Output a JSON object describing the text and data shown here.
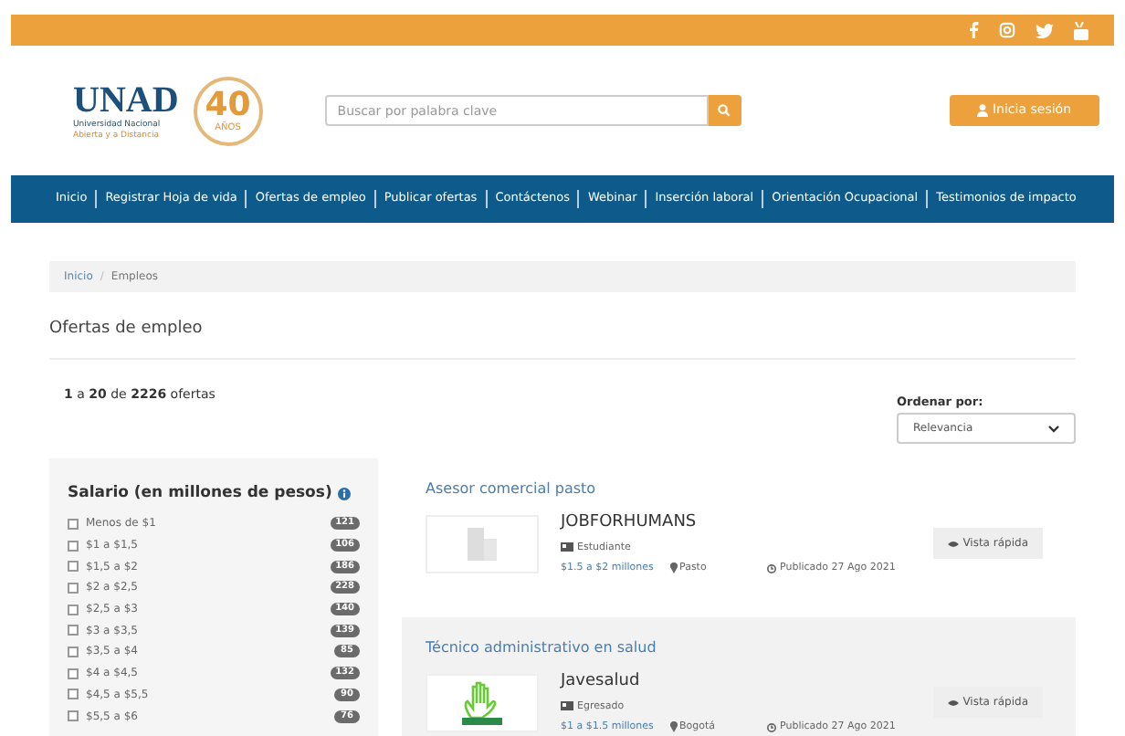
{
  "logo": {
    "name": "UNAD",
    "line_1": "Universidad Nacional",
    "line_2": "Abierta y a Distancia",
    "anniversary_number": "40",
    "anniversary_word": "AÑOS"
  },
  "search": {
    "placeholder": "Buscar por palabra clave"
  },
  "login_button": "Inicia sesión",
  "nav": [
    "Inicio",
    "Registrar Hoja de vida",
    "Ofertas de empleo",
    "Publicar ofertas",
    "Contáctenos",
    "Webinar",
    "Inserción laboral",
    "Orientación Ocupacional",
    "Testimonios de impacto"
  ],
  "breadcrumb": [
    {
      "label": "Inicio",
      "link": true
    },
    {
      "label": "Empleos",
      "link": false
    }
  ],
  "breadcrumb_separator": "/",
  "heading": "Ofertas de empleo",
  "results": "**1** a **20** de **2226** ofertas",
  "sort": {
    "label": "Ordenar por:",
    "value": "Relevancia"
  },
  "filter": {
    "title": "Salario (en millones de pesos)",
    "items": [
      {
        "label": "Menos de $1",
        "count": "121",
        "checked": false
      },
      {
        "label": "$1 a $1,5",
        "count": "106",
        "checked": false
      },
      {
        "label": "$1,5 a $2",
        "count": "186",
        "checked": false
      },
      {
        "label": "$2 a $2,5",
        "count": "228",
        "checked": false
      },
      {
        "label": "$2,5 a $3",
        "count": "140",
        "checked": false
      },
      {
        "label": "$3 a $3,5",
        "count": "139",
        "checked": false
      },
      {
        "label": "$3,5 a $4",
        "count": "85",
        "checked": false
      },
      {
        "label": "$4 a $4,5",
        "count": "132",
        "checked": false
      },
      {
        "label": "$4,5 a $5,5",
        "count": "90",
        "checked": false
      },
      {
        "label": "$5,5 a $6",
        "count": "76",
        "checked": false
      }
    ]
  },
  "jobs": [
    {
      "title": "Asesor comercial pasto",
      "company": "JOBFORHUMANS",
      "kind": "building",
      "level": "Estudiante",
      "salary": "$1.5 a $2 millones",
      "city": "Pasto",
      "published": "Publicado 27 Ago 2021",
      "button": "Vista rápida",
      "highlighted": false
    },
    {
      "title": "Técnico administrativo en salud",
      "company": "Javesalud",
      "kind": "hand",
      "level": "Egresado",
      "salary": "$1 a $1.5 millones",
      "city": "Bogotá",
      "published": "Publicado 27 Ago 2021",
      "button": "Vista rápida",
      "highlighted": true
    }
  ]
}
